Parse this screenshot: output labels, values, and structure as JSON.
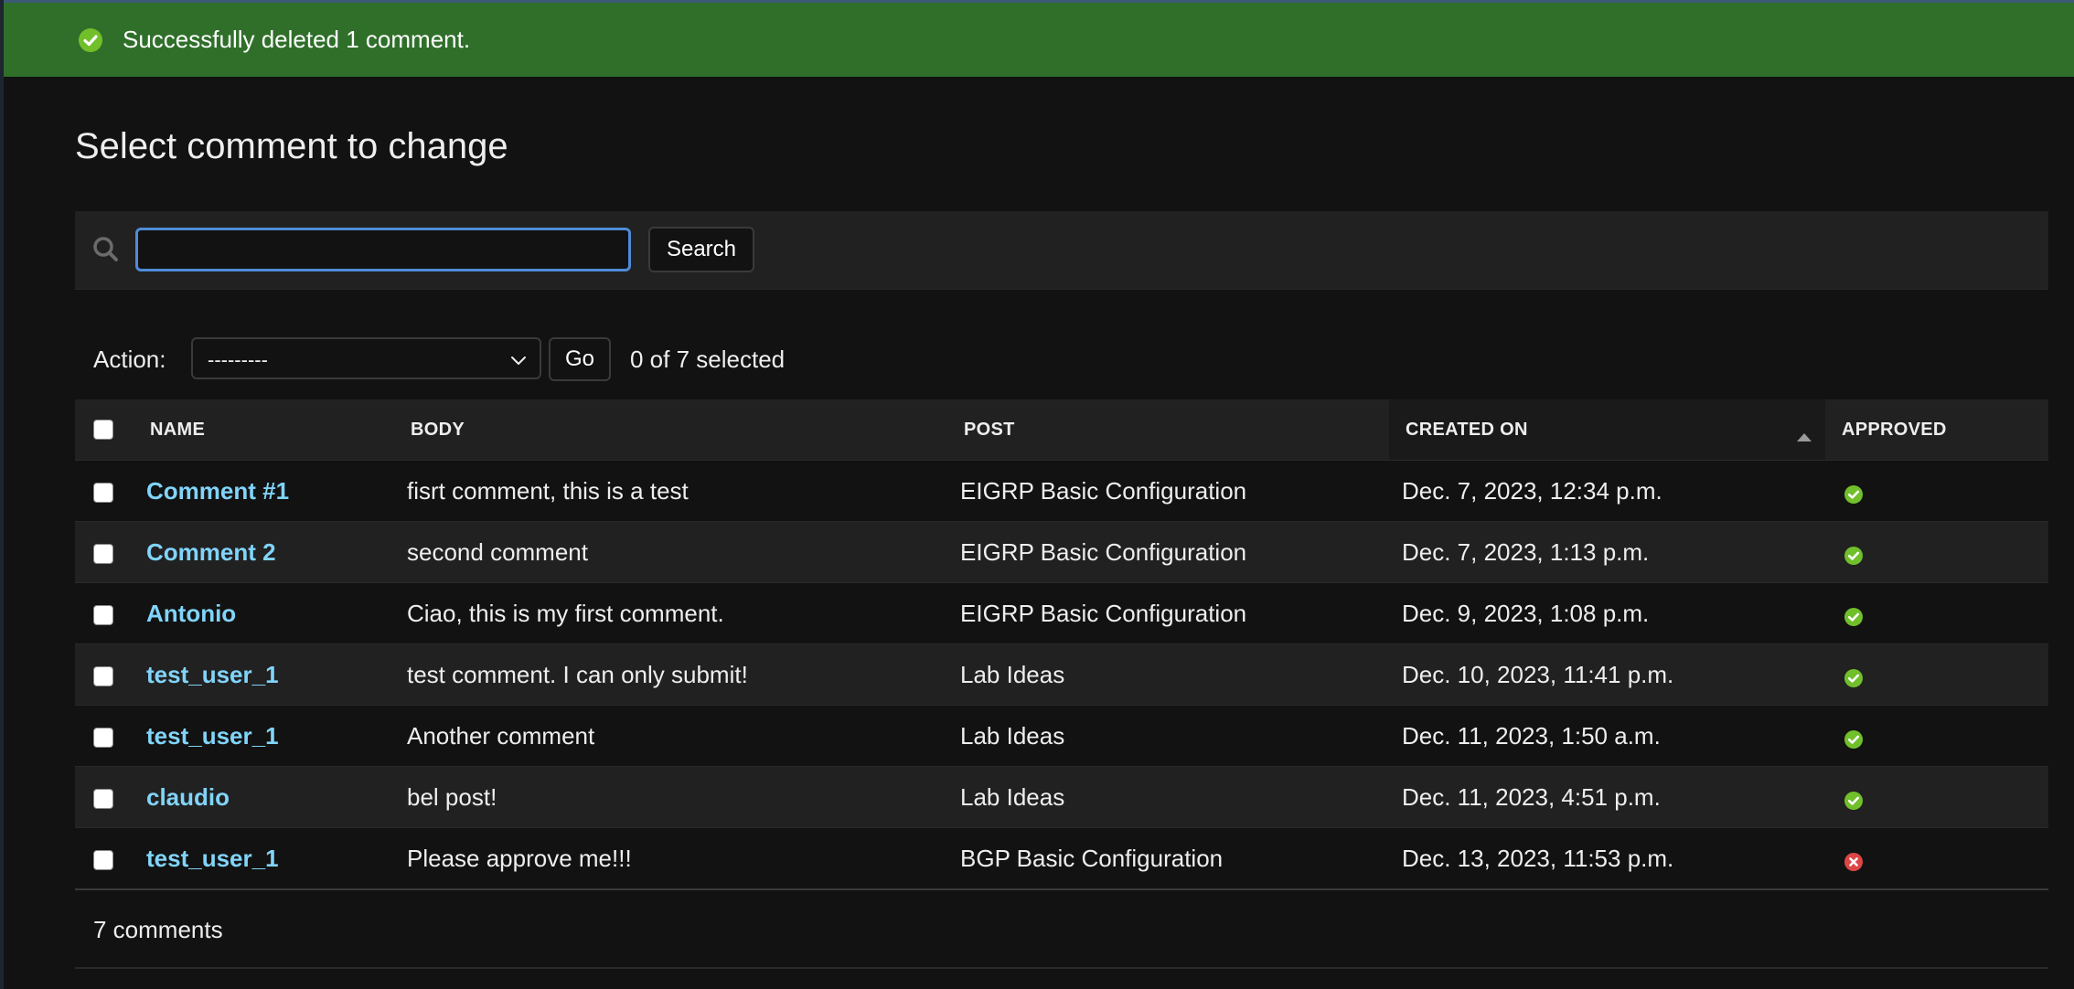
{
  "message": {
    "text": "Successfully deleted 1 comment.",
    "icon": "check-circle-icon",
    "color": "#2f6f2a"
  },
  "page": {
    "title": "Select comment to change"
  },
  "search": {
    "value": "",
    "button_label": "Search",
    "icon": "search-icon"
  },
  "actions": {
    "label": "Action:",
    "selected_option": "---------",
    "go_label": "Go",
    "counter": "0 of 7 selected"
  },
  "table": {
    "columns": [
      "Name",
      "Body",
      "Post",
      "Created on",
      "Approved"
    ],
    "sorted_column": "Created on",
    "sort_direction": "ascending",
    "rows": [
      {
        "name": "Comment #1",
        "body": "fisrt comment, this is a test",
        "post": "EIGRP Basic Configuration",
        "created_on": "Dec. 7, 2023, 12:34 p.m.",
        "approved": true
      },
      {
        "name": "Comment 2",
        "body": "second comment",
        "post": "EIGRP Basic Configuration",
        "created_on": "Dec. 7, 2023, 1:13 p.m.",
        "approved": true
      },
      {
        "name": "Antonio",
        "body": "Ciao, this is my first comment.",
        "post": "EIGRP Basic Configuration",
        "created_on": "Dec. 9, 2023, 1:08 p.m.",
        "approved": true
      },
      {
        "name": "test_user_1",
        "body": "test comment. I can only submit!",
        "post": "Lab Ideas",
        "created_on": "Dec. 10, 2023, 11:41 p.m.",
        "approved": true
      },
      {
        "name": "test_user_1",
        "body": "Another comment",
        "post": "Lab Ideas",
        "created_on": "Dec. 11, 2023, 1:50 a.m.",
        "approved": true
      },
      {
        "name": "claudio",
        "body": "bel post!",
        "post": "Lab Ideas",
        "created_on": "Dec. 11, 2023, 4:51 p.m.",
        "approved": true
      },
      {
        "name": "test_user_1",
        "body": "Please approve me!!!",
        "post": "BGP Basic Configuration",
        "created_on": "Dec. 13, 2023, 11:53 p.m.",
        "approved": false
      }
    ]
  },
  "paginator": {
    "text": "7 comments"
  },
  "colors": {
    "link": "#81d4fa",
    "approved": "#70bf2b",
    "rejected": "#dd4646",
    "focus": "#4f8bd6"
  }
}
